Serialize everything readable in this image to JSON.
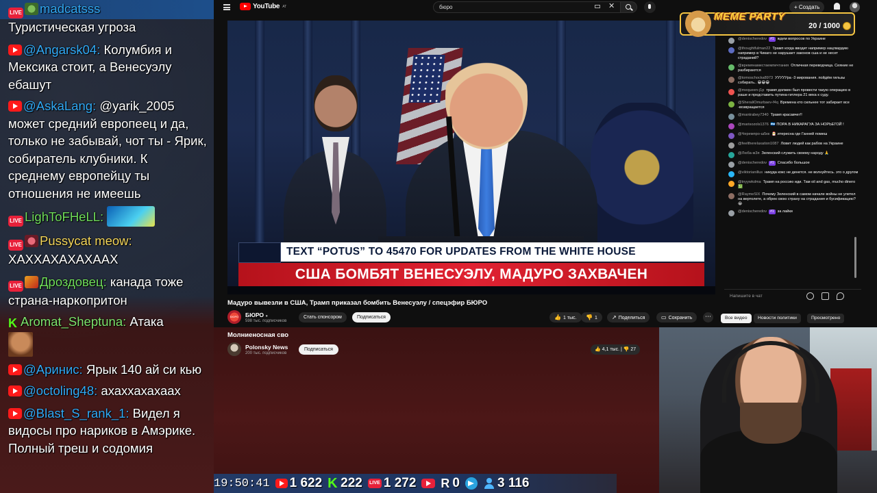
{
  "stream_chat": {
    "messages": [
      {
        "source": "live",
        "user": "madcatsss",
        "text": "Туристическая угроза"
      },
      {
        "source": "youtube",
        "user": "@Angarsk04:",
        "text": "Колумбия и Мексика стоит, а Венесуэлу ебашут"
      },
      {
        "source": "youtube",
        "user": "@AskaLang:",
        "text": "@yarik_2005 может средний европеец и да, только не забывай, чот ты - Ярик, собиратель клубники. К среднему европейцу ты отношения не имеешь"
      },
      {
        "source": "live",
        "user": "LighToFHeLL:",
        "text": ""
      },
      {
        "source": "live",
        "user": "Pussycat meow:",
        "text": "ХАХХАХАХАХААХ"
      },
      {
        "source": "live",
        "user": "Дроздовец:",
        "text": "канада тоже страна-наркопритон"
      },
      {
        "source": "kick",
        "user": "Aromat_Sheptuna:",
        "text": "Атака"
      },
      {
        "source": "youtube",
        "user": "@Аринис:",
        "text": "Ярык 140 ай си кью"
      },
      {
        "source": "youtube",
        "user": "@octoling48:",
        "text": "ахаххахахааx"
      },
      {
        "source": "youtube",
        "user": "@Blast_S_rank_1:",
        "text": "Видел я видосы про нариков в Амэрике. Полный треш и содомия"
      }
    ]
  },
  "youtube": {
    "logo_text": "YouTube",
    "logo_region": "AT",
    "search_value": "бюро",
    "create_label": "Создать",
    "video": {
      "lower_third_top": "TEXT “POTUS” TO 45470 FOR UPDATES FROM THE WHITE HOUSE",
      "lower_third_bottom": "США БОМБЯТ ВЕНЕСУЭЛУ, МАДУРО ЗАХВАЧЕН"
    },
    "title": "Мадуро вывезли в США, Трамп приказал бомбить Венесуэлу / спецэфир БЮРО",
    "channel": {
      "avatar_text": "БЮРО",
      "name": "БЮРО",
      "subs": "598 тыс. подписчиков"
    },
    "sponsor_label": "Стать спонсором",
    "subscribe_label": "Подписаться",
    "likes": "1 тыс.",
    "dislikes": "1",
    "share_label": "Поделиться",
    "save_label": "Сохранить",
    "filters": [
      "Все видео",
      "Новости политики",
      "Просмотрено"
    ],
    "chat_placeholder": "Напишите в чат",
    "live_chat": [
      {
        "user": "@denischeredov",
        "badge": "#1",
        "text": "ждем вопросов по Украине",
        "color": "#9aa0a6"
      },
      {
        "user": "@thoughtfulman22",
        "badge": "",
        "text": "Трамп когда вводит например нацгвардию например в Чикаго не нарушает законов сша и не несет страданий?",
        "color": "#5c6bc0"
      },
      {
        "user": "@времянаместаемпичтания",
        "badge": "",
        "text": "Отличная переводчица. Сеяние не разбираются",
        "color": "#66bb6a"
      },
      {
        "user": "@tomoschocka8973",
        "badge": "",
        "text": "УУУУУра -3 мирования. пойдём гильзы собирать.. 😁😁😁",
        "color": "#8d6e63"
      },
      {
        "user": "@mequeen-j1p",
        "badge": "",
        "text": "трамп должен был провести такую операцию в раше и представить путина-гитлера 21 века к суду.",
        "color": "#ef5350"
      },
      {
        "user": "@SheraliOmurbaev-f4q",
        "badge": "",
        "text": "Времена кто сильнее тот забирает все -возвращается",
        "color": "#7cb342"
      },
      {
        "user": "@mantrabey7340",
        "badge": "",
        "text": "Трамп красавчег!!",
        "color": "#78909c"
      },
      {
        "user": "@marisozols1376",
        "badge": "",
        "text": "🇳🇮 ПОРА В НИКАРАГУА ЗА НОРЬЕГОЙ !",
        "color": "#ab47bc"
      },
      {
        "user": "@Черемпро-ш5кк",
        "badge": "",
        "text": "🎅 итересна где Ганней помеш",
        "color": "#7e57c2"
      },
      {
        "user": "@feelthereIaxation1087",
        "badge": "",
        "text": "Ловит людей как рабов на Украине",
        "color": "#9e9e9e"
      },
      {
        "user": "@Люба-ж3я",
        "badge": "",
        "text": "Зеленский служить своему народу 🙏",
        "color": "#26a69a"
      },
      {
        "user": "@denischeredov",
        "badge": "#1",
        "text": "Спасибо большое",
        "color": "#9aa0a6"
      },
      {
        "user": "@viktorianillus",
        "badge": "",
        "text": "никуда кокс не денется. не волнуйтесь. это о другом",
        "color": "#29b6f6"
      },
      {
        "user": "@tnyywkdma",
        "badge": "",
        "text": "Трамп на россию иди. Там oil and gas, mucho dinero 💹",
        "color": "#ffa726"
      },
      {
        "user": "@RaymeSIX",
        "badge": "",
        "text": "Почему Зеленский в самом начале войны не улетел на вертолете, а обрек свою страну на страдания и бусификацию? 😭",
        "color": "#8d6e63"
      },
      {
        "user": "@denischeredov",
        "badge": "#1",
        "text": "за лайки",
        "color": "#9aa0a6"
      }
    ]
  },
  "below_video": {
    "title": "Молниеносная сво",
    "channel_name": "Polonsky News",
    "channel_subs": "200 тыс. подписчиков",
    "subscribe_label": "Подписаться",
    "likes": "4,1 тыс.",
    "dislikes": "27"
  },
  "meme_party": {
    "title": "MEME PARTY",
    "count": "20 / 1000"
  },
  "stats": {
    "time": "19:50:41",
    "youtube": "1 622",
    "kick": "222",
    "live": "1 272",
    "play": "",
    "rumble": "0",
    "telegram": "",
    "viewers": "3 116"
  }
}
